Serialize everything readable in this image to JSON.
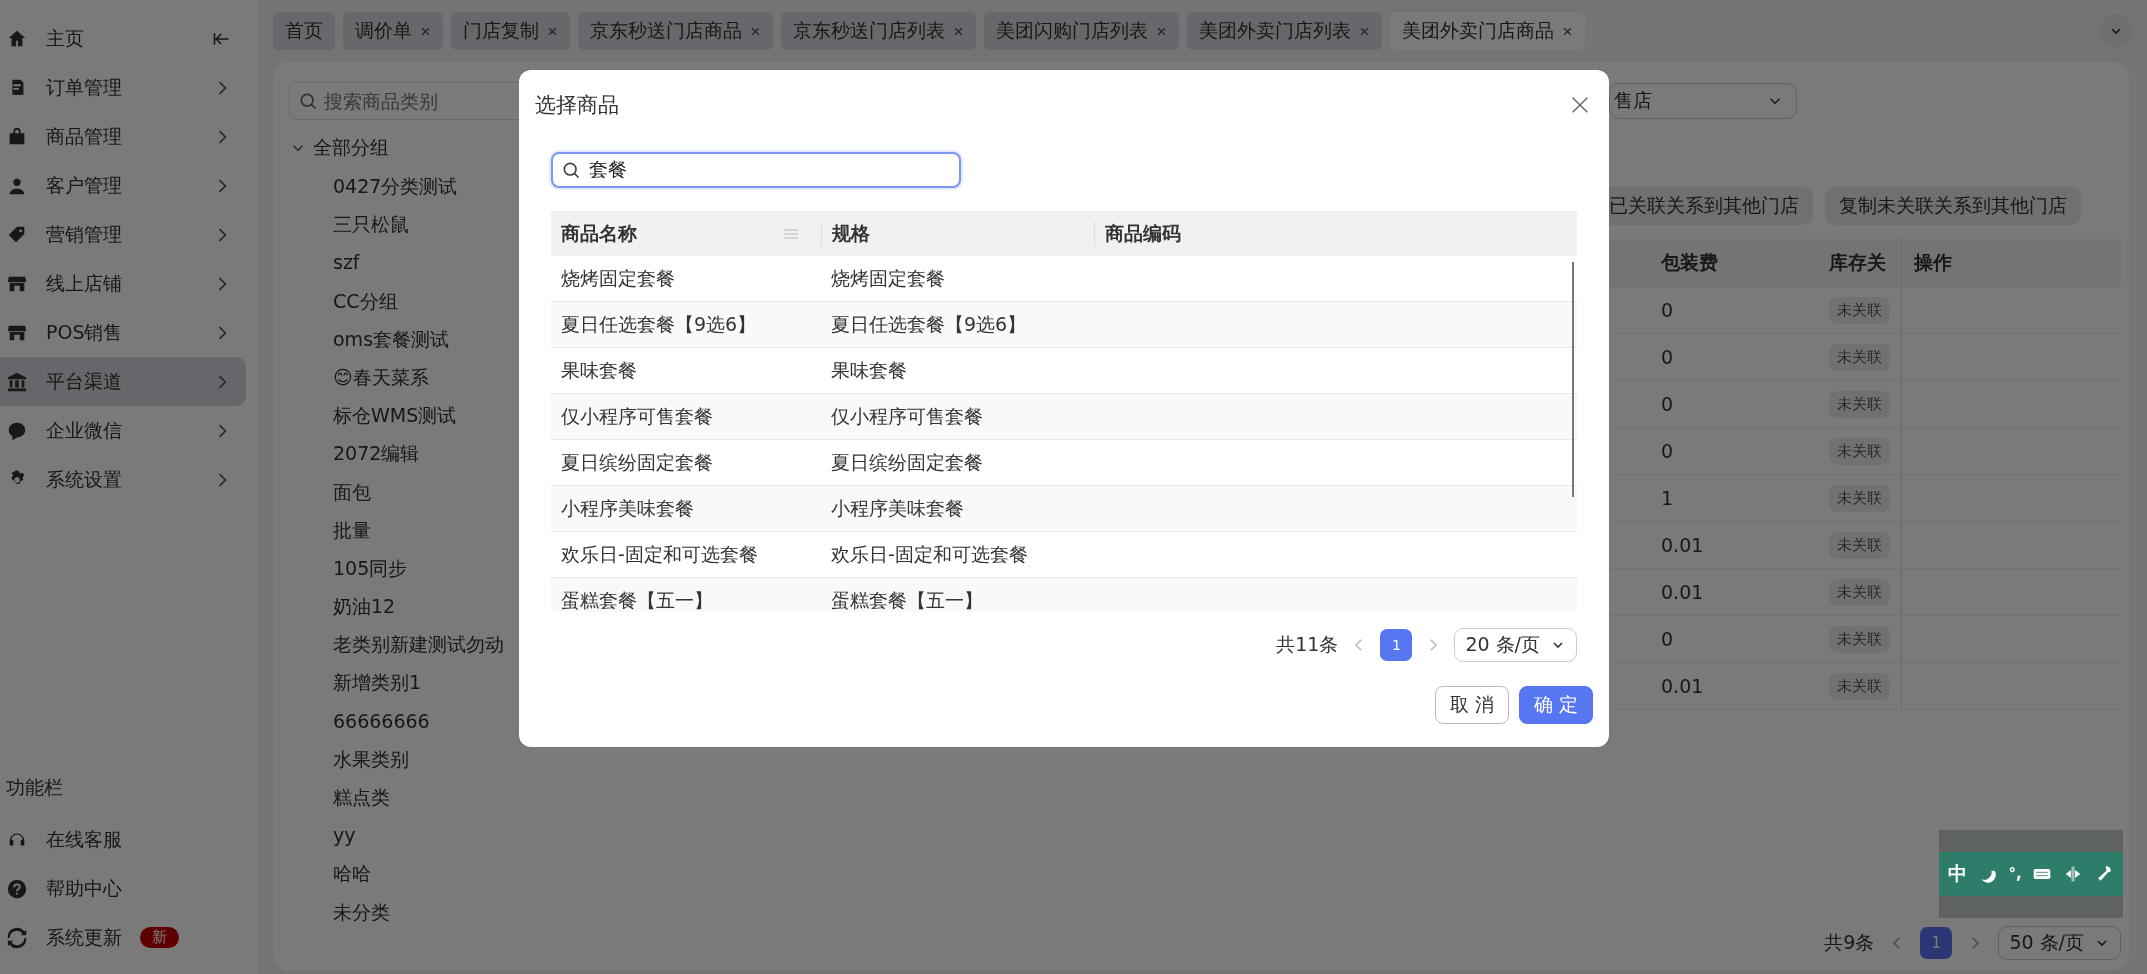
{
  "sidebar": {
    "items": [
      {
        "label": "主页",
        "kind": "home",
        "selected": false
      },
      {
        "label": "订单管理",
        "kind": "orders",
        "selected": false
      },
      {
        "label": "商品管理",
        "kind": "goods",
        "selected": false
      },
      {
        "label": "客户管理",
        "kind": "customers",
        "selected": false
      },
      {
        "label": "营销管理",
        "kind": "marketing",
        "selected": false
      },
      {
        "label": "线上店铺",
        "kind": "shop",
        "selected": false
      },
      {
        "label": "POS销售",
        "kind": "shop",
        "selected": false
      },
      {
        "label": "平台渠道",
        "kind": "channel",
        "selected": true
      },
      {
        "label": "企业微信",
        "kind": "wechat",
        "selected": false
      },
      {
        "label": "系统设置",
        "kind": "settings",
        "selected": false
      }
    ],
    "section_title": "功能栏",
    "bottom_items": [
      {
        "label": "在线客服",
        "kind": "service"
      },
      {
        "label": "帮助中心",
        "kind": "help"
      },
      {
        "label": "系统更新",
        "kind": "update",
        "badge": "新"
      }
    ]
  },
  "tabs": [
    {
      "label": "首页",
      "closable": false,
      "selected": false
    },
    {
      "label": "调价单",
      "closable": true,
      "selected": false
    },
    {
      "label": "门店复制",
      "closable": true,
      "selected": false
    },
    {
      "label": "京东秒送门店商品",
      "closable": true,
      "selected": false
    },
    {
      "label": "京东秒送门店列表",
      "closable": true,
      "selected": false
    },
    {
      "label": "美团闪购门店列表",
      "closable": true,
      "selected": false
    },
    {
      "label": "美团外卖门店列表",
      "closable": true,
      "selected": false
    },
    {
      "label": "美团外卖门店商品",
      "closable": true,
      "selected": true
    }
  ],
  "category_panel": {
    "search_placeholder": "搜索商品类别",
    "tree": [
      {
        "label": "全部分组",
        "expanded": true,
        "children": [
          {
            "label": "0427分类测试"
          },
          {
            "label": "三只松鼠"
          },
          {
            "label": "szf"
          },
          {
            "label": "CC分组"
          },
          {
            "label": "oms套餐测试"
          },
          {
            "label": "😊春天菜系"
          },
          {
            "label": "标仓WMS测试"
          },
          {
            "label": "2072编辑"
          },
          {
            "label": "面包"
          },
          {
            "label": "批量"
          },
          {
            "label": "105同步"
          },
          {
            "label": "奶油12"
          },
          {
            "label": "老类别新建测试勿动"
          },
          {
            "label": "新增类别1"
          },
          {
            "label": "66666666"
          },
          {
            "label": "水果类别"
          },
          {
            "label": "糕点类"
          },
          {
            "label": "yy"
          },
          {
            "label": "哈哈"
          },
          {
            "label": "未分类"
          }
        ]
      }
    ]
  },
  "store_select": {
    "value": "售店"
  },
  "actions": [
    {
      "label": "已关联关系到其他门店"
    },
    {
      "label": "复制未关联关系到其他门店"
    }
  ],
  "table": {
    "columns": [
      "包装费",
      "库存关",
      "操作"
    ],
    "rows": [
      {
        "packing_fee": "0",
        "stock_link": "未关联"
      },
      {
        "packing_fee": "0",
        "stock_link": "未关联"
      },
      {
        "packing_fee": "0",
        "stock_link": "未关联"
      },
      {
        "packing_fee": "0",
        "stock_link": "未关联"
      },
      {
        "packing_fee": "1",
        "stock_link": "未关联"
      },
      {
        "packing_fee": "0.01",
        "stock_link": "未关联"
      },
      {
        "packing_fee": "0.01",
        "stock_link": "未关联"
      },
      {
        "packing_fee": "0",
        "stock_link": "未关联"
      },
      {
        "packing_fee": "0.01",
        "stock_link": "未关联"
      }
    ]
  },
  "pagination": {
    "total": "共9条",
    "pages": [
      {
        "label": "1",
        "selected": true
      }
    ],
    "page_size": "50 条/页"
  },
  "dialog": {
    "title": "选择商品",
    "search": {
      "value": "套餐",
      "focused": true
    },
    "columns": [
      "商品名称",
      "规格",
      "商品编码"
    ],
    "rows": [
      {
        "name": "烧烤固定套餐",
        "spec": "烧烤固定套餐"
      },
      {
        "name": "夏日任选套餐【9选6】",
        "spec": "夏日任选套餐【9选6】"
      },
      {
        "name": "果味套餐",
        "spec": "果味套餐"
      },
      {
        "name": "仅小程序可售套餐",
        "spec": "仅小程序可售套餐"
      },
      {
        "name": "夏日缤纷固定套餐",
        "spec": "夏日缤纷固定套餐"
      },
      {
        "name": "小程序美味套餐",
        "spec": "小程序美味套餐"
      },
      {
        "name": "欢乐日-固定和可选套餐",
        "spec": "欢乐日-固定和可选套餐"
      },
      {
        "name": "蛋糕套餐【五一】",
        "spec": "蛋糕套餐【五一】"
      }
    ],
    "pagination": {
      "total": "共11条",
      "pages": [
        {
          "label": "1",
          "selected": true
        }
      ],
      "page_size": "20 条/页"
    },
    "buttons": [
      {
        "label": "取 消",
        "kind": "secondary"
      },
      {
        "label": "确 定",
        "kind": "primary"
      }
    ]
  },
  "ime_toolbar": {
    "mode": "中",
    "punctuation": "°,"
  }
}
